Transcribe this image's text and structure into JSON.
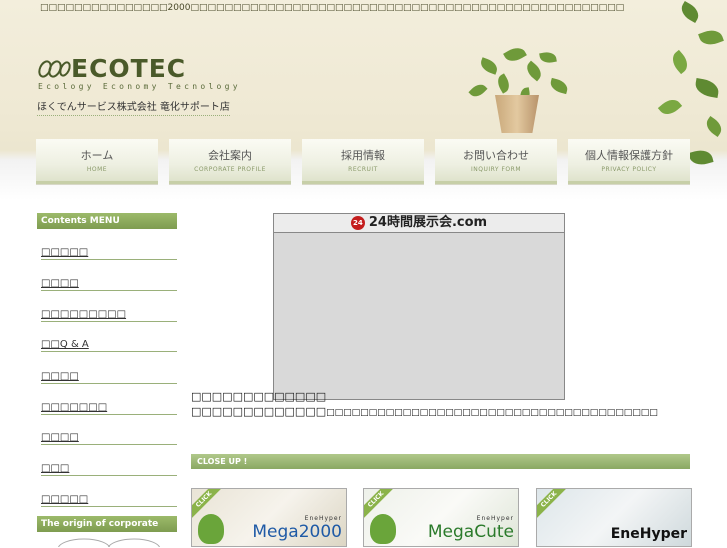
{
  "header": {
    "topline": "□□□□□□□□□□□□□□□2000□□□□□□□□□□□□□□□□□□□□□□□□□□□□□□□□□□□□□□□□□□□□□□□□□□□",
    "logo_text": "ECOTEC",
    "logo_sub": "Ecology Economy Tecnology",
    "company": "ほくでんサービス株式会社 竜化サポート店"
  },
  "nav": [
    {
      "jp": "ホーム",
      "en": "HOME"
    },
    {
      "jp": "会社案内",
      "en": "CORPORATE PROFILE"
    },
    {
      "jp": "採用情報",
      "en": "RECRUIT"
    },
    {
      "jp": "お問い合わせ",
      "en": "INQUIRY FORM"
    },
    {
      "jp": "個人情報保護方針",
      "en": "PRIVACY POLICY"
    }
  ],
  "sidebar": {
    "heading": "Contents MENU",
    "items": [
      "□□□□□",
      "□□□□",
      "□□□□□□□□□",
      "□□Q & A",
      "□□□□",
      "□□□□□□□",
      "□□□□",
      "□□□",
      "□□□□□"
    ],
    "heading2": "The origin of corporate name"
  },
  "main": {
    "banner_badge": "24",
    "banner_title": "24時間展示会.com",
    "text1": "□□□□□□□□□□□□□",
    "text2_main": "□□□□□□□□□□□□□",
    "text2_small": "□□□□□□□□□□□□□□□□□□□□□□□□□□□□□□□□□□□□□□□",
    "closeup": "CLOSE UP !",
    "cards": [
      {
        "click": "CLICK",
        "small": "EneHyper",
        "big": "Mega2000"
      },
      {
        "click": "CLICK",
        "small": "EneHyper",
        "big": "MegaCute"
      },
      {
        "click": "CLICK",
        "small": "",
        "big": "EneHyper"
      }
    ]
  },
  "colors": {
    "accent_green": "#8aa862",
    "logo_green": "#4a5a2a",
    "banner_red": "#c41e1e"
  }
}
